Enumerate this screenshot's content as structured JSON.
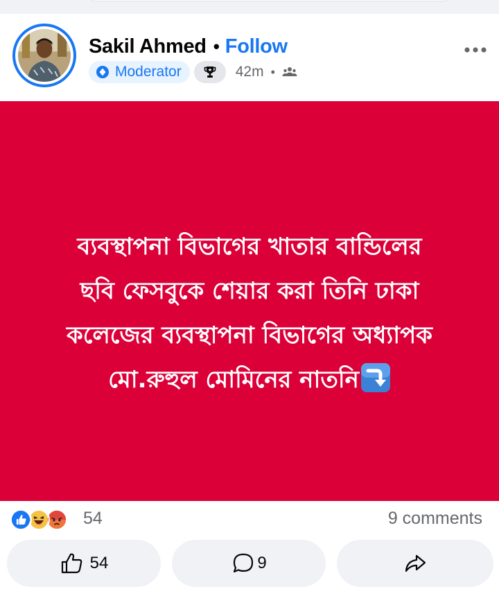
{
  "post": {
    "author_name": "Sakil Ahmed",
    "separator": "•",
    "follow_label": "Follow",
    "badge_label": "Moderator",
    "time": "42m",
    "meta_separator": "•",
    "privacy_icon": "group-icon",
    "more_icon": "more-options-icon",
    "text_lines": [
      "ব্যবস্থাপনা বিভাগের খাতার বান্ডিলের",
      "ছবি ফেসবুকে শেয়ার করা তিনি ঢাকা",
      "কলেজের ব্যবস্থাপনা বিভাগের অধ্যাপক",
      "মো.রুহুল মোমিনের নাতনি"
    ],
    "background_color": "#dc0039"
  },
  "reactions": {
    "icons": [
      "like-reaction-icon",
      "haha-reaction-icon",
      "angry-reaction-icon"
    ],
    "count": "54",
    "comments": "9 comments"
  },
  "actions": {
    "like_count": "54",
    "comment_count": "9",
    "share_icon": "share-icon"
  },
  "colors": {
    "accent": "#1877f2",
    "post_bg": "#dc0039",
    "muted": "#65676b",
    "button_bg": "#f0f2f5"
  }
}
